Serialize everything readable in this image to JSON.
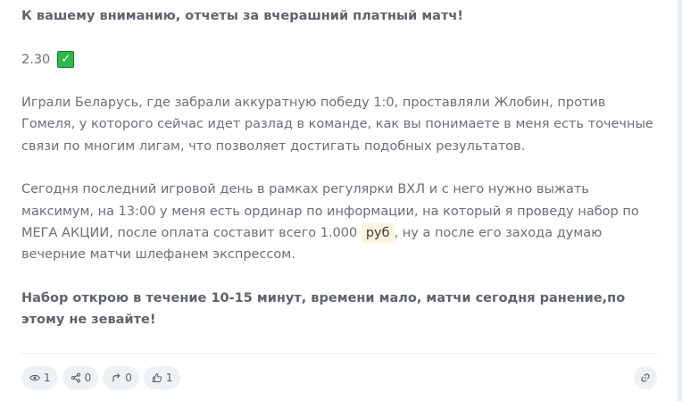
{
  "post": {
    "heading": "К вашему вниманию, отчеты за вчерашний платный матч!",
    "odds": "2.30",
    "result_icon": "check-mark-icon",
    "para1": "Играли Беларусь, где забрали аккуратную победу 1:0, проставляли Жлобин, против Гомеля, у которого сейчас идет разлад в команде, как вы понимаете в меня есть точечные связи по многим лигам, что позволяет достигать подобных результатов.",
    "para2_before": "Сегодня последний игровой день в рамках регулярки ВХЛ и с него нужно выжать максимум, на 13:00 у меня есть ординар по информации, на который я проведу набор по МЕГА АКЦИИ, после оплата составит всего 1.000 ",
    "para2_currency": "руб",
    "para2_after": ", ну а после его захода думаю вечерние матчи шлефанем экспрессом.",
    "closing": "Набор открою в течение 10-15 минут, времени мало, матчи сегодня ранение,по этому не зевайте!"
  },
  "stats": {
    "views": "1",
    "shares": "0",
    "reposts": "0",
    "likes": "1"
  },
  "colors": {
    "text": "#6b6f76",
    "pill_bg": "#eef1f4",
    "check_bg": "#2fb84a",
    "currency_bg": "#fdf3df"
  }
}
